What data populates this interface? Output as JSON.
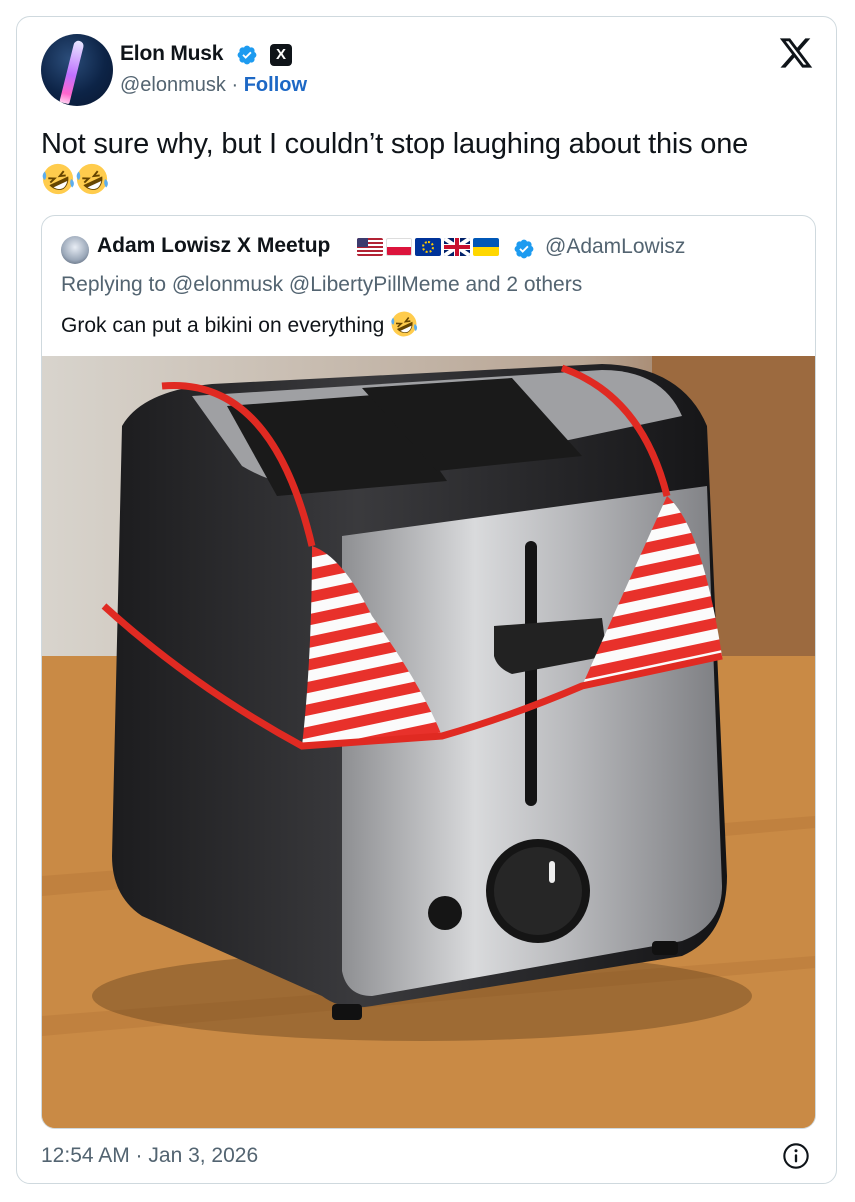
{
  "tweet": {
    "author_name": "Elon Musk",
    "author_handle": "@elonmusk",
    "separator": "·",
    "follow_label": "Follow",
    "text": "Not sure why, but I couldn’t stop laughing about this one",
    "emoji": "rolling-on-floor-laughing",
    "timestamp": "12:54 AM · Jan 3, 2026"
  },
  "quote": {
    "author_name": "Adam Lowisz X Meetup",
    "flags": [
      "us",
      "pl",
      "eu",
      "gb",
      "ua"
    ],
    "author_handle": "@AdamLowisz",
    "reply_line": "Replying to @elonmusk @LibertyPillMeme and 2 others",
    "text": "Grok can put a bikini on everything",
    "image_subject": "stainless toaster wearing red and white striped bikini top"
  },
  "colors": {
    "link": "#1d68c5",
    "verified": "#1d9bf0",
    "secondary_text": "#536471",
    "border": "#cfd9de"
  },
  "icons": [
    "verified-badge-icon",
    "x-premium-badge-icon",
    "x-logo-icon",
    "info-icon"
  ]
}
